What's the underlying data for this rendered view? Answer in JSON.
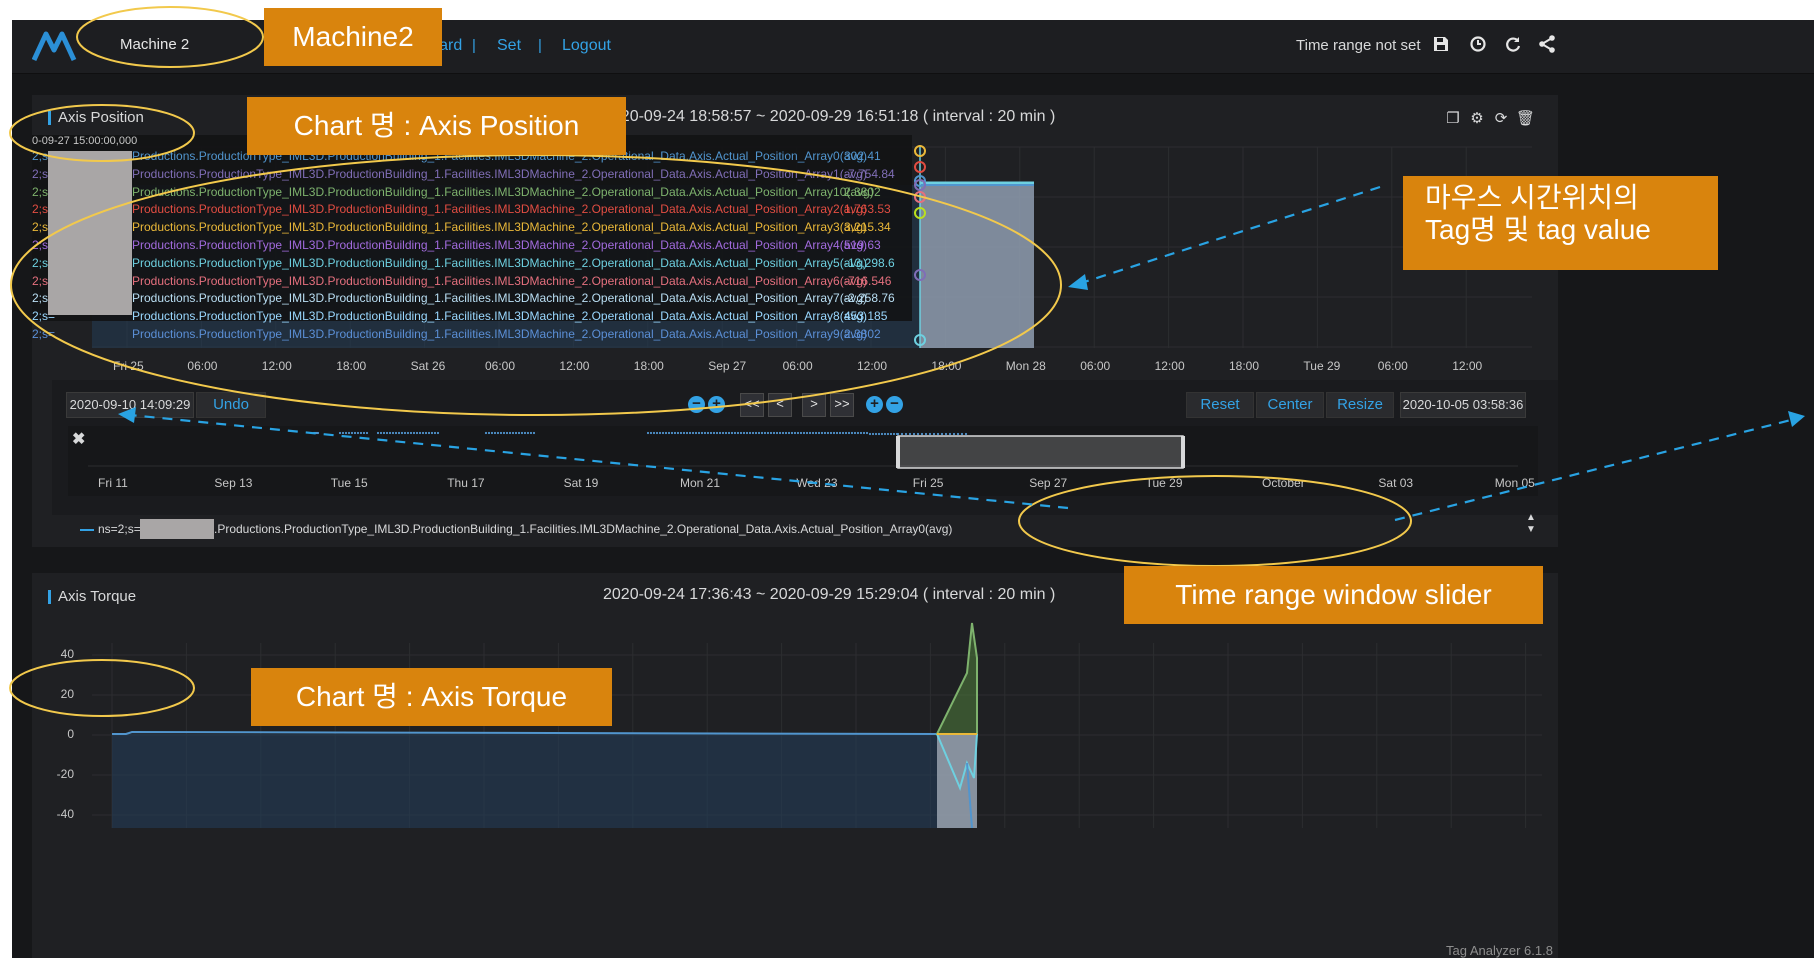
{
  "header": {
    "machine": "Machine 2",
    "nav": [
      "Dashboard",
      "Set",
      "Logout"
    ],
    "nav_sep": "|",
    "time_range": "Time range not set",
    "icons": [
      "save-icon",
      "clock-icon",
      "refresh-icon",
      "share-icon"
    ]
  },
  "panel1": {
    "title": "Axis Position",
    "range": "2020-09-24 18:58:57 ~ 2020-09-29 16:51:18 ( interval : 20 min )",
    "tooltip": {
      "time": "0-09-27 15:00:00,000",
      "rows": [
        {
          "prefix": "2;s=",
          "name": "Productions.ProductionType_IML3D.ProductionBuilding_1.Facilities.IML3DMachine_2.Operational_Data.Axis.Actual_Position_Array0(avg)",
          "value": "302.41",
          "color": "#5195ce"
        },
        {
          "prefix": "2;s=",
          "name": "Productions.ProductionType_IML3D.ProductionBuilding_1.Facilities.IML3DMachine_2.Operational_Data.Axis.Actual_Position_Array1(avg)",
          "value": "-7,754.84",
          "color": "#806eb7"
        },
        {
          "prefix": "2;s=",
          "name": "Productions.ProductionType_IML3D.ProductionBuilding_1.Facilities.IML3DMachine_2.Operational_Data.Axis.Actual_Position_Array10(avg)",
          "value": "2.3802",
          "color": "#7eb26d"
        },
        {
          "prefix": "2;s=",
          "name": "Productions.ProductionType_IML3D.ProductionBuilding_1.Facilities.IML3DMachine_2.Operational_Data.Axis.Actual_Position_Array2(avg)",
          "value": "1,763.53",
          "color": "#e24d42"
        },
        {
          "prefix": "2;s=",
          "name": "Productions.ProductionType_IML3D.ProductionBuilding_1.Facilities.IML3DMachine_2.Operational_Data.Axis.Actual_Position_Array3(avg)",
          "value": "3,215.34",
          "color": "#eab839"
        },
        {
          "prefix": "2;s=",
          "name": "Productions.ProductionType_IML3D.ProductionBuilding_1.Facilities.IML3DMachine_2.Operational_Data.Axis.Actual_Position_Array4(avg)",
          "value": "519.63",
          "color": "#a26bde"
        },
        {
          "prefix": "2;s=",
          "name": "Productions.ProductionType_IML3D.ProductionBuilding_1.Facilities.IML3DMachine_2.Operational_Data.Axis.Actual_Position_Array5(avg)",
          "value": "-13,298.6",
          "color": "#6ed0e0"
        },
        {
          "prefix": "2;s=",
          "name": "Productions.ProductionType_IML3D.ProductionBuilding_1.Facilities.IML3DMachine_2.Operational_Data.Axis.Actual_Position_Array6(avg)",
          "value": "-716.546",
          "color": "#e5707e"
        },
        {
          "prefix": "2;s=",
          "name": "Productions.ProductionType_IML3D.ProductionBuilding_1.Facilities.IML3DMachine_2.Operational_Data.Axis.Actual_Position_Array7(avg)",
          "value": "-2,258.76",
          "color": "#badff4"
        },
        {
          "prefix": "2;s=",
          "name": "Productions.ProductionType_IML3D.ProductionBuilding_1.Facilities.IML3DMachine_2.Operational_Data.Axis.Actual_Position_Array8(avg)",
          "value": "453.185",
          "color": "#9ad8ff"
        },
        {
          "prefix": "2;s=",
          "name": "Productions.ProductionType_IML3D.ProductionBuilding_1.Facilities.IML3DMachine_2.Operational_Data.Axis.Actual_Position_Array9(avg)",
          "value": "2.3802",
          "color": "#5b8fd6"
        }
      ]
    },
    "xticks": [
      "Fri 25",
      "06:00",
      "12:00",
      "18:00",
      "Sat 26",
      "06:00",
      "12:00",
      "18:00",
      "Sep 27",
      "06:00",
      "12:00",
      "18:00",
      "Mon 28",
      "06:00",
      "12:00",
      "18:00",
      "Tue 29",
      "06:00",
      "12:00"
    ],
    "legend": {
      "prefix": "ns=2;s=",
      "name": ".Productions.ProductionType_IML3D.ProductionBuilding_1.Facilities.IML3DMachine_2.Operational_Data.Axis.Actual_Position_Array0(avg)"
    }
  },
  "slider": {
    "start": "2020-09-10 14:09:29",
    "end": "2020-10-05 03:58:36",
    "undo": "Undo",
    "reset": "Reset",
    "center": "Center",
    "resize": "Resize",
    "nav_buttons": [
      "<<",
      "<",
      ">",
      ">>"
    ],
    "xticks": [
      "Fri 11",
      "Sep 13",
      "Tue 15",
      "Thu 17",
      "Sat 19",
      "Mon 21",
      "Wed 23",
      "Fri 25",
      "Sep 27",
      "Tue 29",
      "October",
      "Sat 03",
      "Mon 05"
    ]
  },
  "panel2": {
    "title": "Axis Torque",
    "range": "2020-09-24 17:36:43 ~ 2020-09-29 15:29:04 ( interval : 20 min )",
    "yticks": [
      "40",
      "20",
      "0",
      "-20",
      "-40"
    ]
  },
  "footer": {
    "version": "Tag Analyzer 6.1.8"
  },
  "annotations": {
    "machine": "Machine2",
    "chart1": "Chart 명 : Axis Position",
    "tooltip_line1": "마우스 시간위치의",
    "tooltip_line2": "Tag명 및 tag value",
    "slider": "Time range window slider",
    "chart2": "Chart 명 : Axis Torque"
  },
  "colors": {
    "accent": "#33a2e5",
    "annotation_box": "#d9840d",
    "annotation_ellipse": "#f2c94c",
    "background": "#161719",
    "panel": "#1f2023"
  }
}
